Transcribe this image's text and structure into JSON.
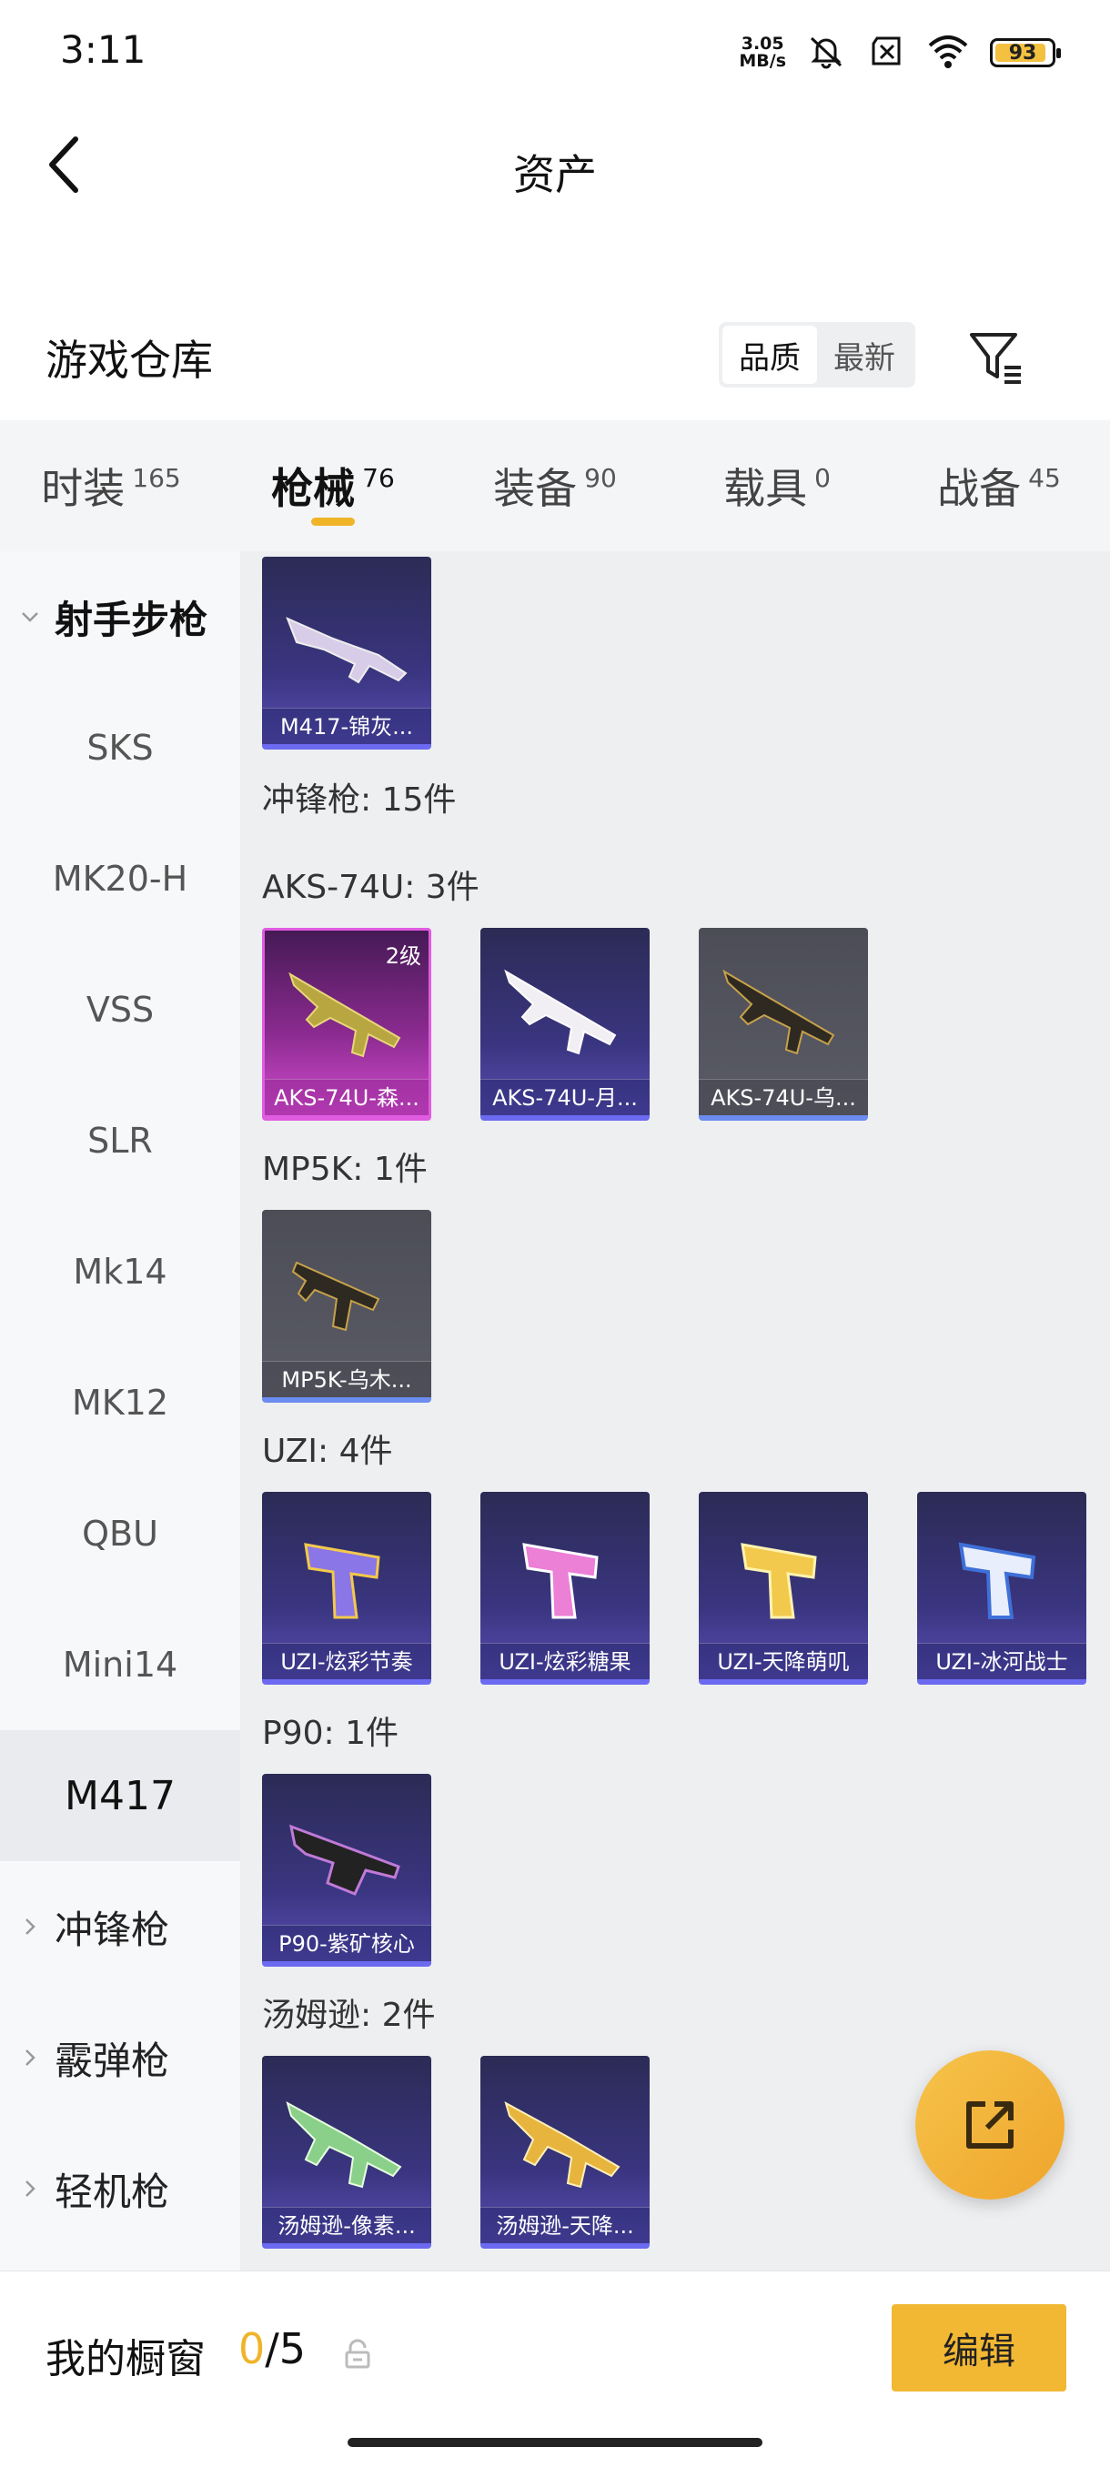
{
  "status": {
    "time": "3:11",
    "net_speed_value": "3.05",
    "net_speed_unit": "MB/s",
    "battery": "93",
    "battery_level": 0.93
  },
  "nav": {
    "title": "资产"
  },
  "warehouse": {
    "title": "游戏仓库",
    "sort_options": [
      "品质",
      "最新"
    ],
    "sort_selected": "品质"
  },
  "tabs": [
    {
      "label": "时装",
      "count": "165"
    },
    {
      "label": "枪械",
      "count": "76"
    },
    {
      "label": "装备",
      "count": "90"
    },
    {
      "label": "载具",
      "count": "0"
    },
    {
      "label": "战备",
      "count": "45"
    }
  ],
  "active_tab": "枪械",
  "sidebar": {
    "group_open": "射手步枪",
    "items": [
      "SKS",
      "MK20-H",
      "VSS",
      "SLR",
      "Mk14",
      "MK12",
      "QBU",
      "Mini14",
      "M417"
    ],
    "selected": "M417",
    "groups_closed": [
      "冲锋枪",
      "霰弹枪",
      "轻机枪"
    ]
  },
  "content": {
    "m417_cards": [
      {
        "name": "M417-锦灰...",
        "tier": "purple"
      }
    ],
    "smg_header": "冲锋枪: 15件",
    "sections": [
      {
        "label": "AKS-74U: 3件",
        "cards": [
          {
            "name": "AKS-74U-森...",
            "level": "2级",
            "tier": "pink"
          },
          {
            "name": "AKS-74U-月...",
            "tier": "purple"
          },
          {
            "name": "AKS-74U-乌...",
            "tier": "grey"
          }
        ]
      },
      {
        "label": "MP5K: 1件",
        "cards": [
          {
            "name": "MP5K-乌木...",
            "tier": "grey"
          }
        ]
      },
      {
        "label": "UZI: 4件",
        "cards": [
          {
            "name": "UZI-炫彩节奏",
            "tier": "purple"
          },
          {
            "name": "UZI-炫彩糖果",
            "tier": "purple"
          },
          {
            "name": "UZI-天降萌叽",
            "tier": "purple"
          },
          {
            "name": "UZI-冰河战士",
            "tier": "purple"
          }
        ]
      },
      {
        "label": "P90: 1件",
        "cards": [
          {
            "name": "P90-紫矿核心",
            "tier": "purple"
          }
        ]
      },
      {
        "label": "汤姆逊: 2件",
        "cards": [
          {
            "name": "汤姆逊-像素...",
            "tier": "purple"
          },
          {
            "name": "汤姆逊-天降...",
            "tier": "purple"
          }
        ]
      }
    ]
  },
  "bottom": {
    "label": "我的橱窗",
    "current": "0",
    "separator": "/",
    "max": "5",
    "edit_label": "编辑"
  },
  "colors": {
    "accent": "#f0b429",
    "purple_tier": "#6b6af0",
    "pink_tier": "#e05ce0"
  }
}
